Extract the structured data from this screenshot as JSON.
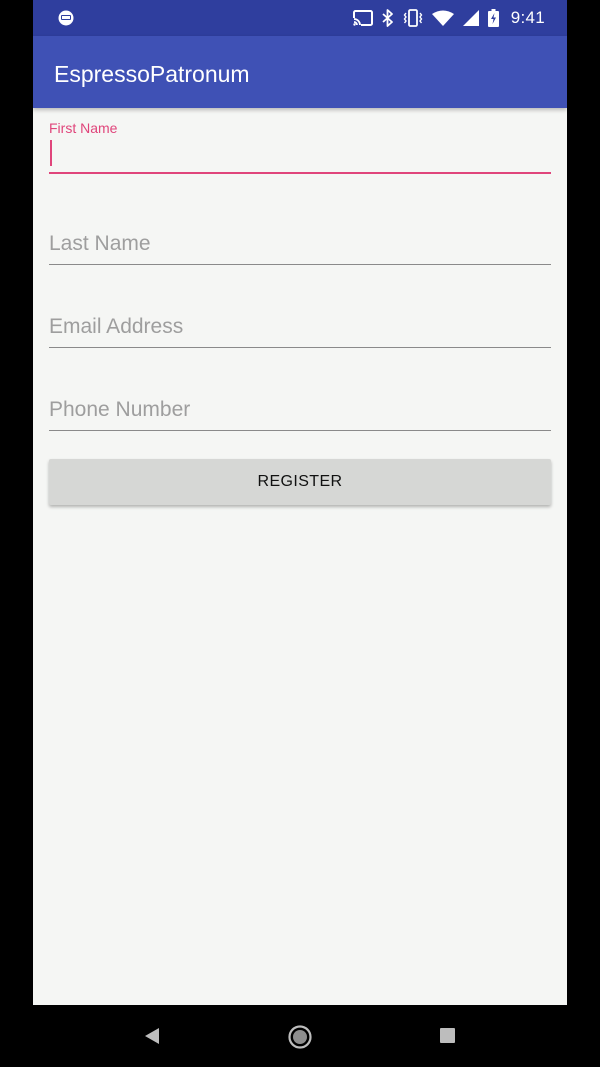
{
  "status_bar": {
    "time": "9:41",
    "icons": [
      "notification-app-icon",
      "cast-icon",
      "bluetooth-icon",
      "vibrate-icon",
      "wifi-icon",
      "cell-signal-icon",
      "battery-charging-icon"
    ]
  },
  "app_bar": {
    "title": "EspressoPatronum"
  },
  "form": {
    "first_name": {
      "label": "First Name",
      "value": ""
    },
    "last_name": {
      "placeholder": "Last Name"
    },
    "email": {
      "placeholder": "Email Address"
    },
    "phone": {
      "placeholder": "Phone Number"
    },
    "register_label": "REGISTER"
  },
  "colors": {
    "status_bar": "#2f3e9e",
    "app_bar": "#3f51b5",
    "accent": "#e0457b",
    "background": "#f5f6f4",
    "button": "#d6d7d5"
  },
  "nav_bar": {
    "buttons": [
      "back-icon",
      "home-icon",
      "recents-icon"
    ]
  }
}
